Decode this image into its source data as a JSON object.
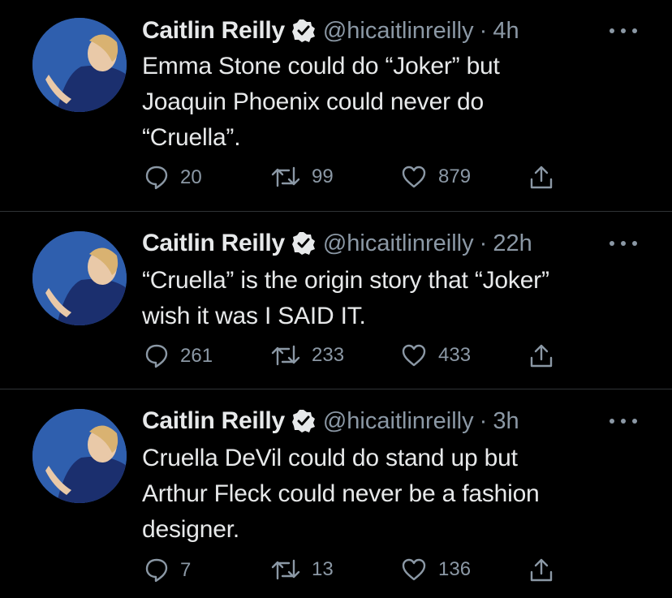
{
  "tweets": [
    {
      "name": "Caitlin Reilly",
      "handle": "@hicaitlinreilly",
      "separator": "·",
      "time": "4h",
      "lines": [
        "Emma Stone could do “Joker” but",
        "Joaquin Phoenix could never do",
        "“Cruella”."
      ],
      "replies": "20",
      "retweets": "99",
      "likes": "879"
    },
    {
      "name": "Caitlin Reilly",
      "handle": "@hicaitlinreilly",
      "separator": "·",
      "time": "22h",
      "lines": [
        "“Cruella” is the origin story that “Joker”",
        "wish it was I SAID IT."
      ],
      "replies": "261",
      "retweets": "233",
      "likes": "433"
    },
    {
      "name": "Caitlin Reilly",
      "handle": "@hicaitlinreilly",
      "separator": "·",
      "time": "3h",
      "lines": [
        "Cruella DeVil could do stand up but",
        "Arthur Fleck could never be a fashion",
        "designer."
      ],
      "replies": "7",
      "retweets": "13",
      "likes": "136"
    }
  ],
  "icons": {
    "reply": "reply-icon",
    "retweet": "retweet-icon",
    "like": "heart-icon",
    "share": "share-icon",
    "more": "more-icon",
    "verified": "verified-badge-icon"
  },
  "colors": {
    "background": "#000000",
    "text": "#e7e9ea",
    "secondary": "#8b98a5",
    "divider": "#2f3336"
  }
}
